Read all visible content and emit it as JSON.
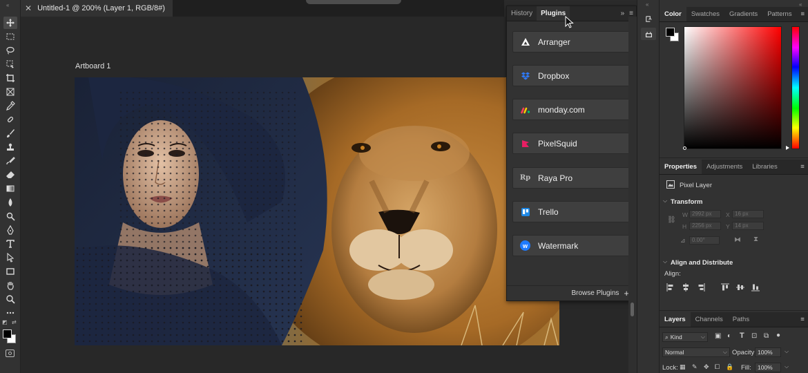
{
  "document": {
    "tab_title": "Untitled-1 @ 200% (Layer 1, RGB/8#)",
    "artboard_label": "Artboard 1"
  },
  "toolbar": {
    "tools": [
      "move",
      "marquee",
      "lasso",
      "object-select",
      "crop",
      "frame",
      "eyedropper",
      "healing",
      "brush",
      "stamp",
      "history-brush",
      "eraser",
      "gradient",
      "blur",
      "dodge",
      "pen",
      "type",
      "path-select",
      "rectangle",
      "hand",
      "zoom",
      "more"
    ]
  },
  "plugins_panel": {
    "tabs": [
      "History",
      "Plugins"
    ],
    "active_tab": "Plugins",
    "expand_glyph": "»",
    "menu_glyph": "≡",
    "items": [
      {
        "label": "Arranger",
        "icon": "arranger-icon",
        "color": "#ffffff"
      },
      {
        "label": "Dropbox",
        "icon": "dropbox-icon",
        "color": "#2f7bff"
      },
      {
        "label": "monday.com",
        "icon": "monday-icon",
        "color": "#ff3d57"
      },
      {
        "label": "PixelSquid",
        "icon": "pixelsquid-icon",
        "color": "#e91e63"
      },
      {
        "label": "Raya Pro",
        "icon": "raya-pro-icon",
        "color": "#bdbdbd"
      },
      {
        "label": "Trello",
        "icon": "trello-icon",
        "color": "#1e88e5"
      },
      {
        "label": "Watermark",
        "icon": "watermark-icon",
        "color": "#1e7bff"
      }
    ],
    "raya_logo_text": "Rp",
    "watermark_logo_text": "w",
    "browse_label": "Browse Plugins",
    "browse_glyph": "+"
  },
  "color_panel": {
    "tabs": [
      "Color",
      "Swatches",
      "Gradients",
      "Patterns"
    ],
    "active_tab": "Color",
    "foreground": "#000000",
    "background": "#ffffff",
    "hue": "#ff0000"
  },
  "properties_panel": {
    "tabs": [
      "Properties",
      "Adjustments",
      "Libraries"
    ],
    "active_tab": "Properties",
    "layer_type": "Pixel Layer",
    "transform_title": "Transform",
    "w_label": "W",
    "w_value": "2992 px",
    "x_label": "X",
    "x_value": "16 px",
    "h_label": "H",
    "h_value": "2256 px",
    "y_label": "Y",
    "y_value": "14 px",
    "angle_value": "0.00°",
    "align_title": "Align and Distribute",
    "align_label": "Align:"
  },
  "layers_panel": {
    "tabs": [
      "Layers",
      "Channels",
      "Paths"
    ],
    "active_tab": "Layers",
    "filter_value": "Kind",
    "blend_mode": "Normal",
    "opacity_label": "Opacity:",
    "opacity_value": "100%",
    "lock_label": "Lock:",
    "fill_label": "Fill:",
    "fill_value": "100%"
  }
}
